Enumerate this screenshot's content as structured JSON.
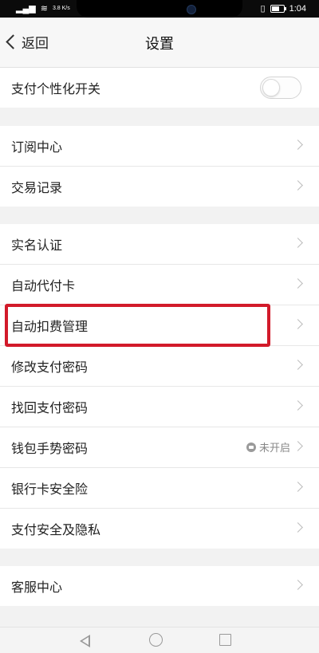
{
  "status_bar": {
    "network": "4G",
    "speed": "3.8 K/s",
    "battery_icon": "battery-icon",
    "time": "1:04"
  },
  "header": {
    "back_label": "返回",
    "title": "设置"
  },
  "groups": [
    {
      "items": [
        {
          "label": "支付个性化开关",
          "control": "toggle",
          "toggle_on": false
        }
      ]
    },
    {
      "items": [
        {
          "label": "订阅中心"
        },
        {
          "label": "交易记录"
        }
      ]
    },
    {
      "items": [
        {
          "label": "实名认证"
        },
        {
          "label": "自动代付卡"
        },
        {
          "label": "自动扣费管理",
          "highlighted": true,
          "highlight_color": "#d21a2a"
        },
        {
          "label": "修改支付密码"
        },
        {
          "label": "找回支付密码"
        },
        {
          "label": "钱包手势密码",
          "status": "未开启"
        },
        {
          "label": "银行卡安全险"
        },
        {
          "label": "支付安全及隐私"
        }
      ]
    },
    {
      "items": [
        {
          "label": "客服中心"
        }
      ]
    }
  ],
  "nav_bar": {
    "icons": [
      "nav-back-icon",
      "nav-home-icon",
      "nav-recent-apps-icon"
    ]
  }
}
